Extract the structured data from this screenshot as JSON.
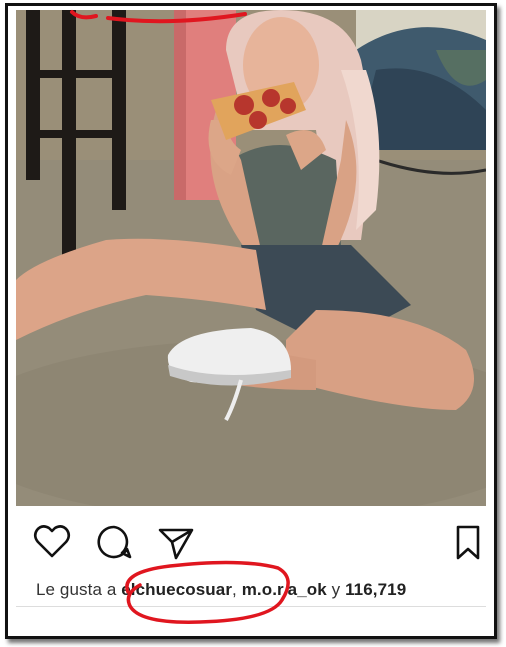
{
  "post": {
    "photo_alt": "Photo",
    "liked_by_prefix": "Le gusta a ",
    "liked_by_user1": "elchuecosuar",
    "separator": ", ",
    "liked_by_user2": "m.o.r.a_ok",
    "conjunction": " y ",
    "likes_count": "116,719"
  },
  "icons": {
    "like": "heart-icon",
    "comment": "comment-icon",
    "share": "send-icon",
    "save": "bookmark-icon"
  },
  "colors": {
    "annotation": "#e0161f",
    "frame": "#111111"
  }
}
